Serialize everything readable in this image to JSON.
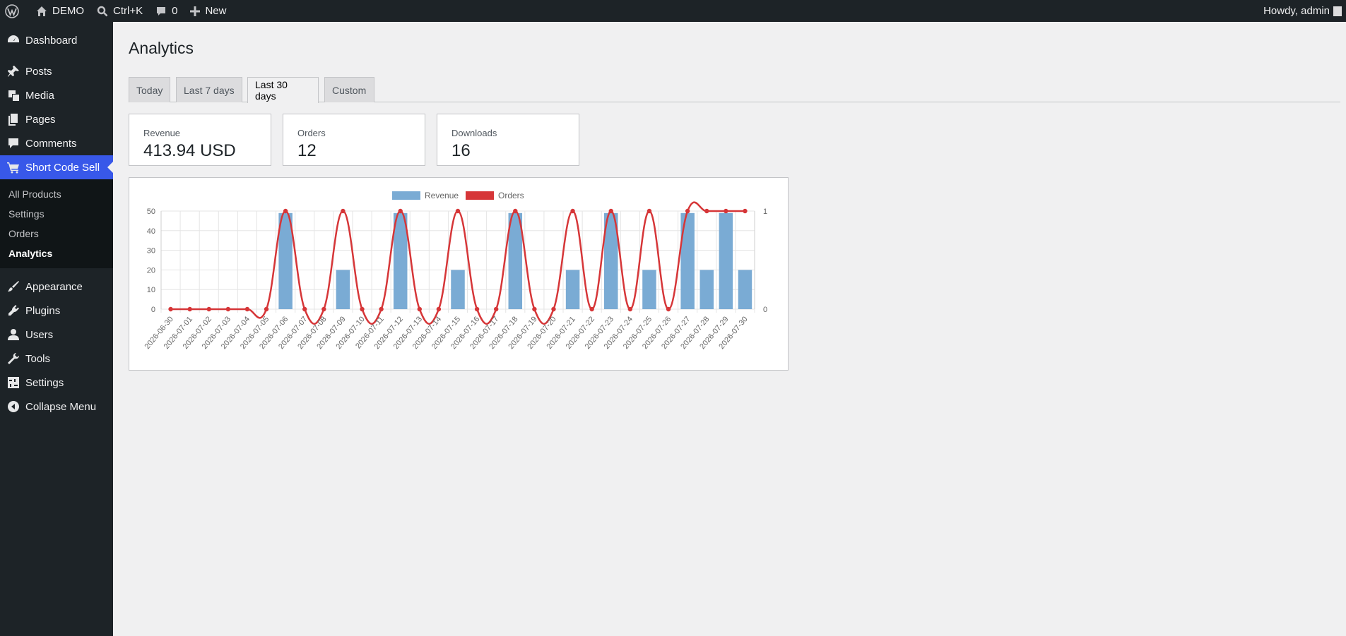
{
  "admin_bar": {
    "site_name": "DEMO",
    "search_shortcut": "Ctrl+K",
    "comments_count": "0",
    "new_label": "New",
    "greeting": "Howdy, admin"
  },
  "sidebar": {
    "items": [
      {
        "label": "Dashboard",
        "icon": "dashboard-icon"
      },
      {
        "label": "Posts",
        "icon": "pin-icon"
      },
      {
        "label": "Media",
        "icon": "media-icon"
      },
      {
        "label": "Pages",
        "icon": "pages-icon"
      },
      {
        "label": "Comments",
        "icon": "comment-icon"
      },
      {
        "label": "Short Code Sell",
        "icon": "cart-icon"
      },
      {
        "label": "Appearance",
        "icon": "brush-icon"
      },
      {
        "label": "Plugins",
        "icon": "plugin-icon"
      },
      {
        "label": "Users",
        "icon": "user-icon"
      },
      {
        "label": "Tools",
        "icon": "wrench-icon"
      },
      {
        "label": "Settings",
        "icon": "settings-icon"
      },
      {
        "label": "Collapse Menu",
        "icon": "collapse-icon"
      }
    ],
    "submenu": [
      "All Products",
      "Settings",
      "Orders",
      "Analytics"
    ],
    "active_submenu": "Analytics"
  },
  "page": {
    "title": "Analytics",
    "tabs": [
      "Today",
      "Last 7 days",
      "Last 30 days",
      "Custom"
    ],
    "active_tab": "Last 30 days"
  },
  "stats": {
    "revenue": {
      "label": "Revenue",
      "value": "413.94 USD"
    },
    "orders": {
      "label": "Orders",
      "value": "12"
    },
    "downloads": {
      "label": "Downloads",
      "value": "16"
    }
  },
  "colors": {
    "accent": "#3858e9",
    "revenue_bar": "#7aabd4",
    "orders_line": "#d63638"
  },
  "chart_data": {
    "type": "bar",
    "categories": [
      "2026-06-30",
      "2026-07-01",
      "2026-07-02",
      "2026-07-03",
      "2026-07-04",
      "2026-07-05",
      "2026-07-06",
      "2026-07-07",
      "2026-07-08",
      "2026-07-09",
      "2026-07-10",
      "2026-07-11",
      "2026-07-12",
      "2026-07-13",
      "2026-07-14",
      "2026-07-15",
      "2026-07-16",
      "2026-07-17",
      "2026-07-18",
      "2026-07-19",
      "2026-07-20",
      "2026-07-21",
      "2026-07-22",
      "2026-07-23",
      "2026-07-24",
      "2026-07-25",
      "2026-07-26",
      "2026-07-27",
      "2026-07-28",
      "2026-07-29",
      "2026-07-30"
    ],
    "series": [
      {
        "name": "Revenue",
        "type": "bar",
        "axis": "left",
        "values": [
          0,
          0,
          0,
          0,
          0,
          0,
          49,
          0,
          0,
          20,
          0,
          0,
          49,
          0,
          0,
          20,
          0,
          0,
          49,
          0,
          0,
          20,
          0,
          49,
          0,
          20,
          0,
          49,
          20,
          49,
          20
        ]
      },
      {
        "name": "Orders",
        "type": "line",
        "axis": "right",
        "values": [
          0,
          0,
          0,
          0,
          0,
          0,
          1,
          0,
          0,
          1,
          0,
          0,
          1,
          0,
          0,
          1,
          0,
          0,
          1,
          0,
          0,
          1,
          0,
          1,
          0,
          1,
          0,
          1,
          1,
          1,
          1
        ]
      }
    ],
    "ylim_left": [
      0,
      50
    ],
    "yticks_left": [
      0,
      10,
      20,
      30,
      40,
      50
    ],
    "ylim_right": [
      0,
      1
    ],
    "yticks_right": [
      0,
      1
    ],
    "legend": "top-center",
    "grid": true
  }
}
